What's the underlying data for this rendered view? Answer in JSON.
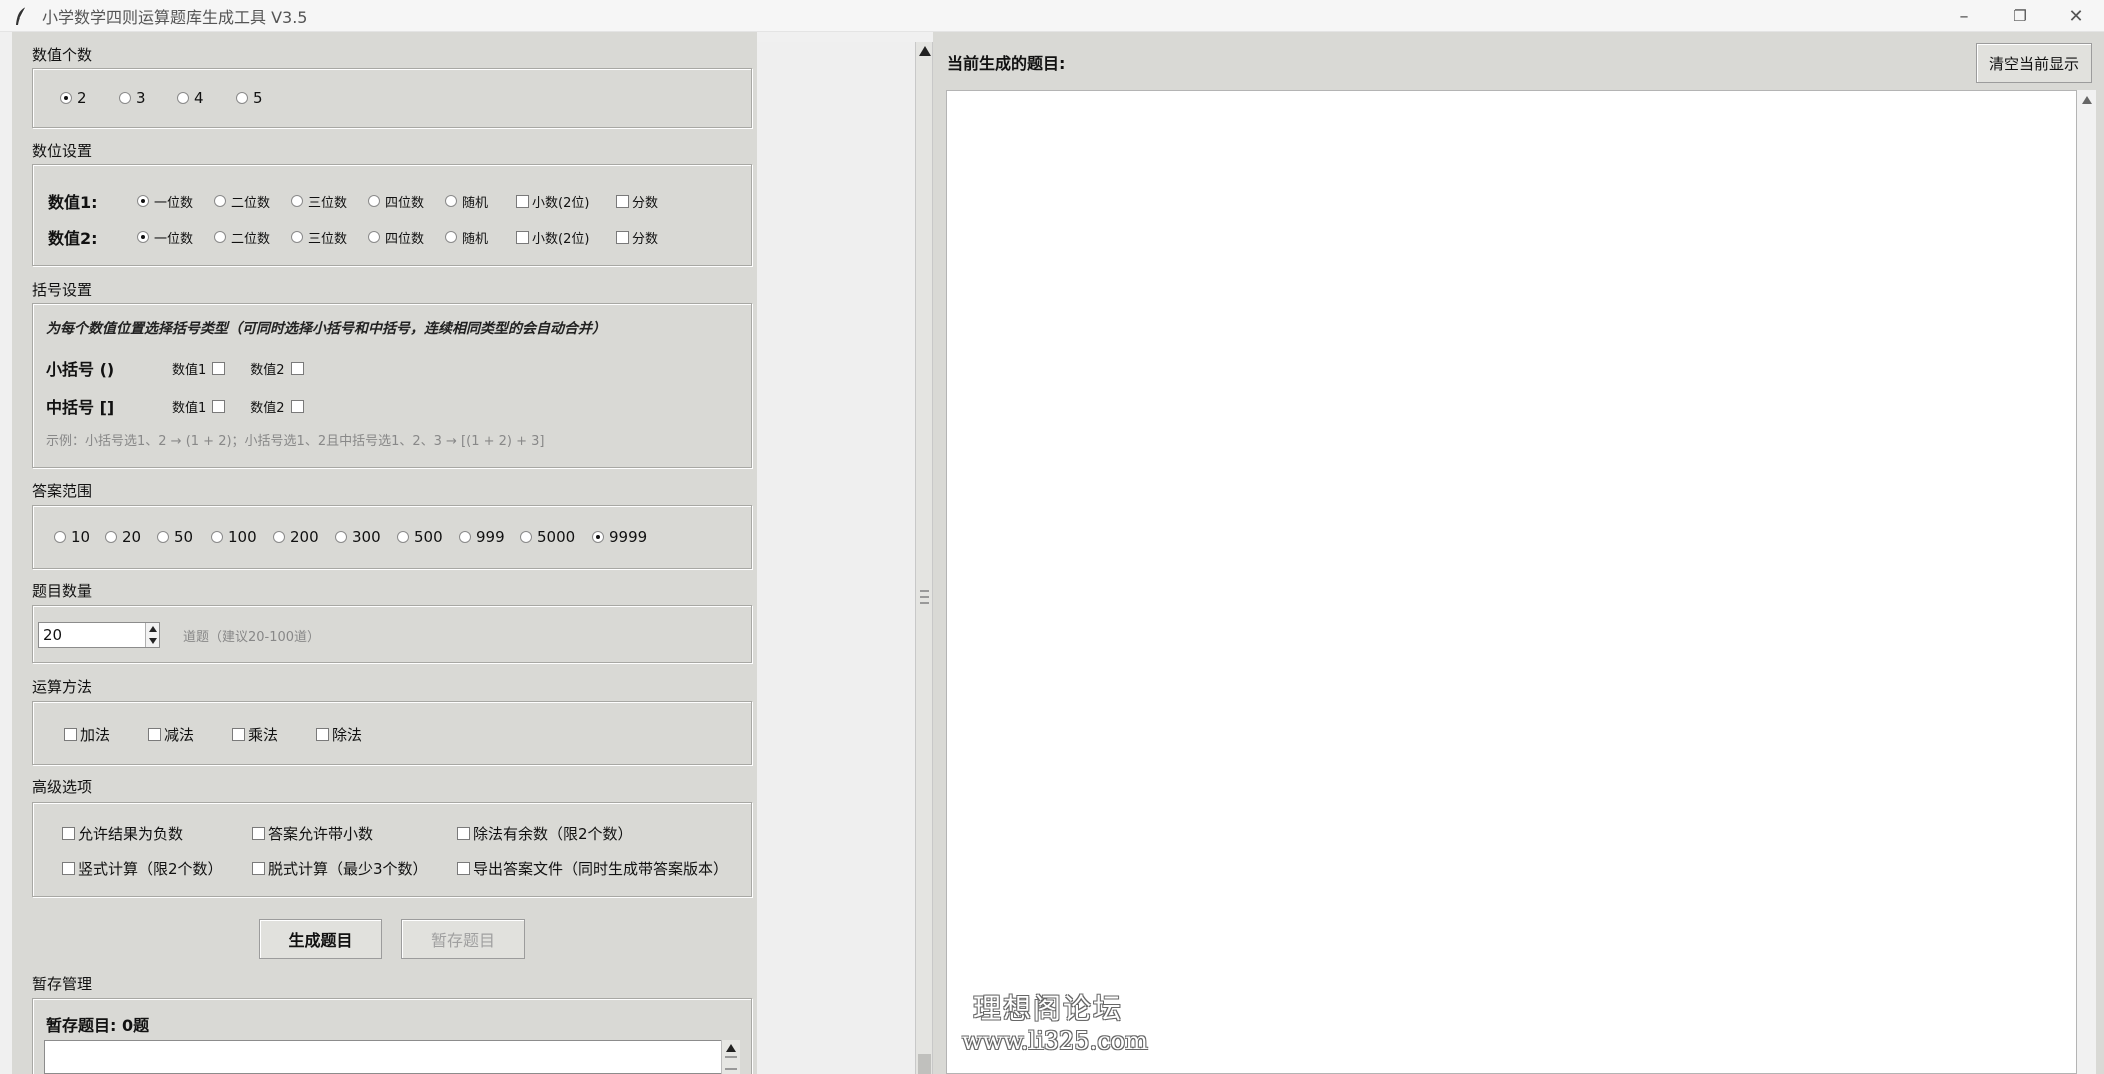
{
  "window": {
    "title": "小学数学四则运算题库生成工具 V3.5",
    "min_symbol": "–",
    "restore_symbol": "❐",
    "close_symbol": "✕",
    "app_icon": "feather-icon"
  },
  "num_count": {
    "title": "数值个数",
    "options": [
      {
        "label": "2",
        "selected": true
      },
      {
        "label": "3",
        "selected": false
      },
      {
        "label": "4",
        "selected": false
      },
      {
        "label": "5",
        "selected": false
      }
    ]
  },
  "digit_settings": {
    "title": "数位设置",
    "rows": [
      {
        "label": "数值1:",
        "radios": [
          "一位数",
          "二位数",
          "三位数",
          "四位数",
          "随机"
        ],
        "selected": 0,
        "checks": [
          "小数(2位)",
          "分数"
        ]
      },
      {
        "label": "数值2:",
        "radios": [
          "一位数",
          "二位数",
          "三位数",
          "四位数",
          "随机"
        ],
        "selected": 0,
        "checks": [
          "小数(2位)",
          "分数"
        ]
      }
    ]
  },
  "brackets": {
    "title": "括号设置",
    "note": "为每个数值位置选择括号类型（可同时选择小括号和中括号，连续相同类型的会自动合并）",
    "rows": [
      {
        "label": "小括号 ()",
        "checks": [
          "数值1",
          "数值2"
        ]
      },
      {
        "label": "中括号 []",
        "checks": [
          "数值1",
          "数值2"
        ]
      }
    ],
    "example": "示例：小括号选1、2 → (1 + 2)；小括号选1、2且中括号选1、2、3 → [(1 + 2) + 3]"
  },
  "answer_range": {
    "title": "答案范围",
    "options": [
      "10",
      "20",
      "50",
      "100",
      "200",
      "300",
      "500",
      "999",
      "5000",
      "9999"
    ],
    "selected": 9
  },
  "question_count": {
    "title": "题目数量",
    "value": "20",
    "suffix": "道题（建议20-100道）"
  },
  "operations": {
    "title": "运算方法",
    "options": [
      "加法",
      "减法",
      "乘法",
      "除法"
    ]
  },
  "advanced": {
    "title": "高级选项",
    "row1": [
      "允许结果为负数",
      "答案允许带小数",
      "除法有余数（限2个数）"
    ],
    "row2": [
      "竖式计算（限2个数）",
      "脱式计算（最少3个数）",
      "导出答案文件（同时生成带答案版本）"
    ]
  },
  "actions": {
    "generate": "生成题目",
    "stash": "暂存题目"
  },
  "stash": {
    "title": "暂存管理",
    "count": "暂存题目: 0题"
  },
  "output": {
    "title": "当前生成的题目:",
    "clear": "清空当前显示"
  },
  "watermark": {
    "line1": "理想阁论坛",
    "line2": "www.li325.com"
  }
}
